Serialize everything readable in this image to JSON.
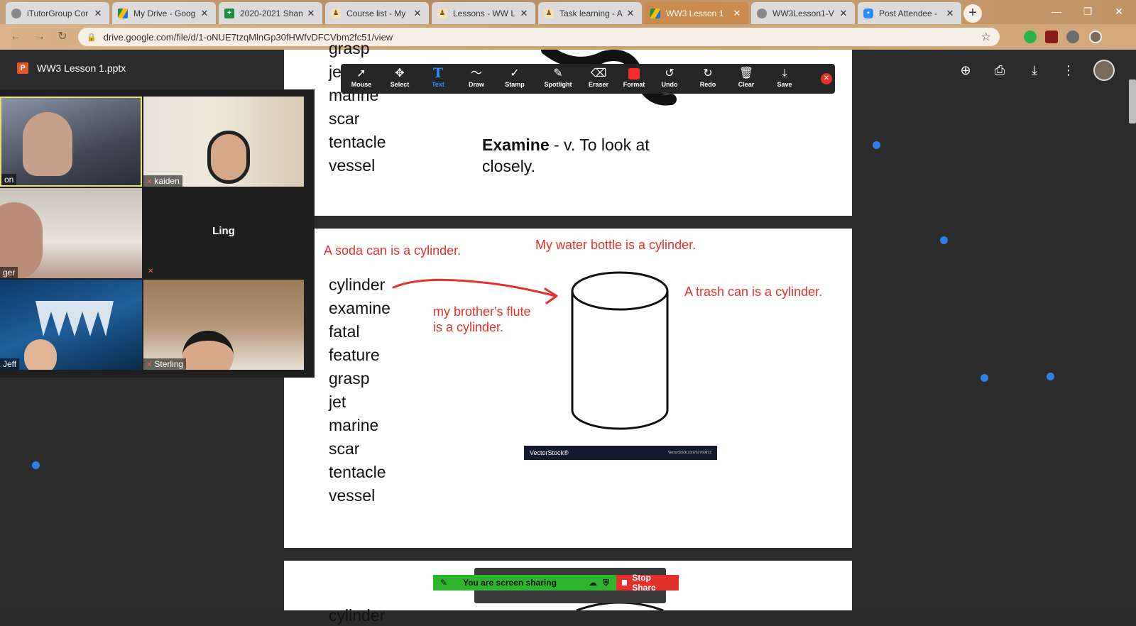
{
  "browser": {
    "tabs": [
      {
        "label": "iTutorGroup Cor",
        "icon": "globe-icon",
        "color": "#777777"
      },
      {
        "label": "My Drive - Goog",
        "icon": "drive-icon",
        "color": "#1a73e8"
      },
      {
        "label": "2020-2021 Shan",
        "icon": "sheets-icon",
        "color": "#1e8e3e"
      },
      {
        "label": "Course list - My",
        "icon": "moodle-icon",
        "color": "#c08b2b"
      },
      {
        "label": "Lessons - WW L",
        "icon": "moodle-icon",
        "color": "#c08b2b"
      },
      {
        "label": "Task learning - A",
        "icon": "moodle-icon",
        "color": "#c08b2b"
      },
      {
        "label": "WW3 Lesson 1",
        "icon": "drive-icon",
        "color": "#1a73e8"
      },
      {
        "label": "WW3Lesson1-V",
        "icon": "globe-icon",
        "color": "#777777"
      },
      {
        "label": "Post Attendee -",
        "icon": "zoom-icon",
        "color": "#2d8cff"
      }
    ],
    "new_tab": "+",
    "url": "drive.google.com/file/d/1-oNUE7tzqMlnGp30fHWfvDFCVbm2fc51/view"
  },
  "viewer": {
    "title": "WW3 Lesson 1.pptx",
    "file_badge": "P"
  },
  "slide1": {
    "words": [
      "grasp",
      "jet",
      "marine",
      "scar",
      "tentacle",
      "vessel"
    ],
    "def_term": "Examine",
    "def_rest": " - v. To look at closely."
  },
  "slide2": {
    "words": [
      "cylinder",
      "examine",
      "fatal",
      "feature",
      "grasp",
      "jet",
      "marine",
      "scar",
      "tentacle",
      "vessel"
    ],
    "annotations": {
      "soda": "A soda can is a cylinder.",
      "bottle": "My water bottle is a cylinder.",
      "trash": "A trash can is a cylinder.",
      "flute_1": "my brother's flute",
      "flute_2": "is a cylinder."
    },
    "stock_brand": "VectorStock®",
    "stock_url": "VectorStock.com/33760972"
  },
  "slide3": {
    "word": "cylinder"
  },
  "gallery": {
    "participants": [
      "on",
      "kaiden",
      "ger",
      "Ling",
      "Jeff",
      "Sterling"
    ]
  },
  "annotate_toolbar": {
    "tools": [
      {
        "label": "Mouse",
        "icon": "mouse-pointer-icon"
      },
      {
        "label": "Select",
        "icon": "move-icon"
      },
      {
        "label": "Text",
        "icon": "text-icon"
      },
      {
        "label": "Draw",
        "icon": "draw-icon"
      },
      {
        "label": "Stamp",
        "icon": "stamp-icon"
      },
      {
        "label": "Spotlight",
        "icon": "spotlight-icon"
      },
      {
        "label": "Eraser",
        "icon": "eraser-icon"
      },
      {
        "label": "Format",
        "icon": "format-icon"
      },
      {
        "label": "Undo",
        "icon": "undo-icon"
      },
      {
        "label": "Redo",
        "icon": "redo-icon"
      },
      {
        "label": "Clear",
        "icon": "trash-icon"
      },
      {
        "label": "Save",
        "icon": "save-icon"
      }
    ],
    "active_color": "#ff2a2a",
    "text_tool_color": "#2d8cff"
  },
  "share_bar": {
    "status": "You are screen sharing",
    "stop": "Stop Share"
  }
}
